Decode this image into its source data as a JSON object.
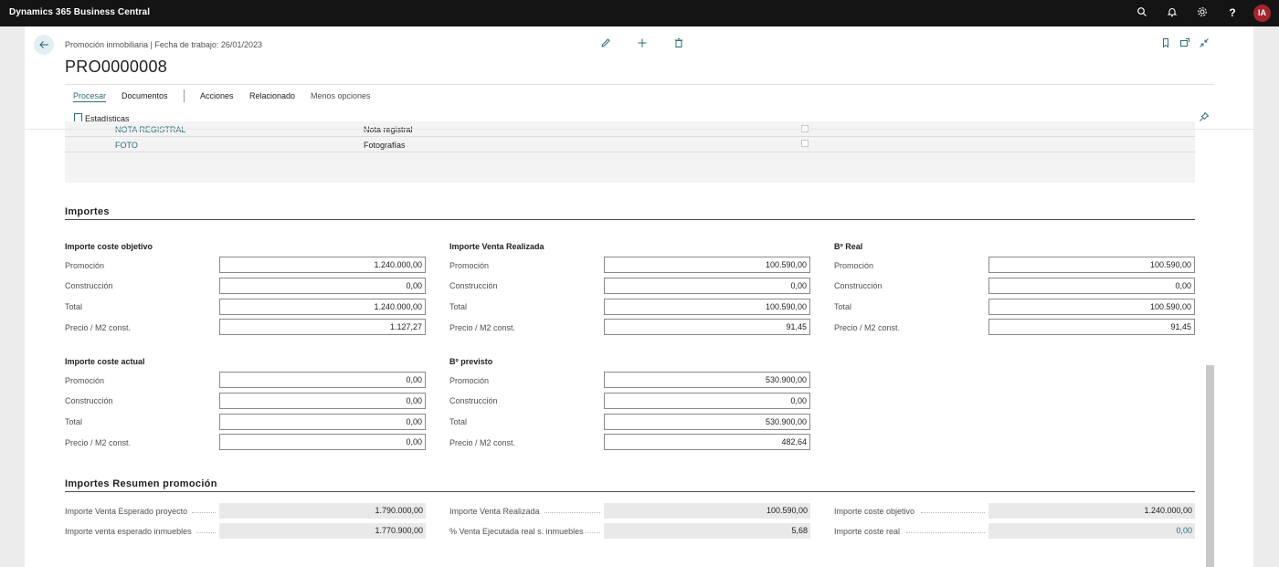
{
  "app": {
    "title": "Dynamics 365 Business Central",
    "avatar_initials": "IA"
  },
  "topbar_icons": [
    "search-icon",
    "bell-icon",
    "gear-icon",
    "help-icon"
  ],
  "header": {
    "breadcrumb": "Promoción inmobiliaria | Fecha de trabajo: 26/01/2023",
    "title": "PRO0000008"
  },
  "menu": {
    "procesar": "Procesar",
    "documentos": "Documentos",
    "acciones": "Acciones",
    "relacionado": "Relacionado",
    "menos": "Menos opciones",
    "estadisticas": "Estadísticas"
  },
  "grid_rows": [
    {
      "code": "NOTA REGISTRAL",
      "desc": "Nota registral"
    },
    {
      "code": "FOTO",
      "desc": "Fotografías"
    }
  ],
  "importes": {
    "title": "Importes",
    "labels": {
      "promocion": "Promoción",
      "construccion": "Construcción",
      "total": "Total",
      "precio": "Precio / M2 const."
    },
    "coste_objetivo": {
      "title": "Importe coste objetivo",
      "promocion": "1.240.000,00",
      "construccion": "0,00",
      "total": "1.240.000,00",
      "precio": "1.127,27"
    },
    "venta_realizada": {
      "title": "Importe Venta Realizada",
      "promocion": "100.590,00",
      "construccion": "0,00",
      "total": "100.590,00",
      "precio": "91,45"
    },
    "b_real": {
      "title": "Bº Real",
      "promocion": "100.590,00",
      "construccion": "0,00",
      "total": "100.590,00",
      "precio": "91,45"
    },
    "coste_actual": {
      "title": "Importe coste actual",
      "promocion": "0,00",
      "construccion": "0,00",
      "total": "0,00",
      "precio": "0,00"
    },
    "b_previsto": {
      "title": "Bº previsto",
      "promocion": "530.900,00",
      "construccion": "0,00",
      "total": "530.900,00",
      "precio": "482,64"
    }
  },
  "resumen": {
    "title": "Importes Resumen promoción",
    "venta_esperado_proyecto": {
      "label": "Importe Venta Esperado proyecto",
      "value": "1.790.000,00"
    },
    "venta_esperado_inmuebles": {
      "label": "Importe venta esperado inmuebles",
      "value": "1.770.900,00"
    },
    "venta_realizada": {
      "label": "Importe Venta Realizada",
      "value": "100.590,00"
    },
    "pct_venta": {
      "label": "% Venta Ejecutada real s. inmuebles",
      "value": "5,68"
    },
    "coste_objetivo": {
      "label": "Importe coste objetivo",
      "value": "1.240.000,00"
    },
    "coste_real": {
      "label": "Importe coste real",
      "value": "0,00"
    }
  }
}
